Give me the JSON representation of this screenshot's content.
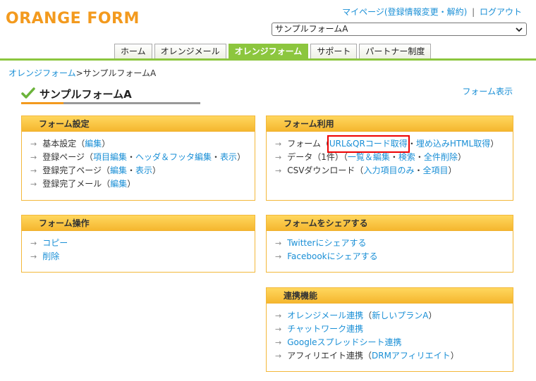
{
  "logo": {
    "text": "ORANGE FORM"
  },
  "top_links": {
    "mypage": "マイページ(登録情報変更・解約)",
    "separator": "|",
    "logout": "ログアウト"
  },
  "form_select": {
    "selected": "サンプルフォームA"
  },
  "tabs": [
    {
      "label": "ホーム"
    },
    {
      "label": "オレンジメール"
    },
    {
      "label": "オレンジフォーム"
    },
    {
      "label": "サポート"
    },
    {
      "label": "パートナー制度"
    }
  ],
  "breadcrumb": {
    "root": "オレンジフォーム",
    "sep": ">",
    "current": "サンプルフォームA"
  },
  "page_title": "サンプルフォームA",
  "form_view_link": "フォーム表示",
  "panels": {
    "settings": {
      "title": "フォーム設定",
      "basic": {
        "label": "基本設定（",
        "edit": "編集",
        "close": "）"
      },
      "regpage": {
        "label": "登録ページ（",
        "fields": "項目編集",
        "dot1": "・",
        "header": "ヘッダ＆フッタ編集",
        "dot2": "・",
        "view": "表示",
        "close": "）"
      },
      "donepage": {
        "label": "登録完了ページ（",
        "edit": "編集",
        "dot": "・",
        "view": "表示",
        "close": "）"
      },
      "donemail": {
        "label": "登録完了メール（",
        "edit": "編集",
        "close": "）"
      }
    },
    "usage": {
      "title": "フォーム利用",
      "form": {
        "label": "フォーム（",
        "url": "URL&QRコード取得",
        "dot": "・",
        "embed": "埋め込みHTML取得",
        "close": "）"
      },
      "data": {
        "label": "データ（1件）（",
        "list": "一覧＆編集",
        "dot1": "・",
        "search": "検索",
        "dot2": "・",
        "delete": "全件削除",
        "close": "）"
      },
      "csv": {
        "label": "CSVダウンロード（",
        "input": "入力項目のみ",
        "dot": "・",
        "all": "全項目",
        "close": "）"
      }
    },
    "ops": {
      "title": "フォーム操作",
      "copy": "コピー",
      "delete": "削除"
    },
    "share": {
      "title": "フォームをシェアする",
      "twitter": "Twitterにシェアする",
      "facebook": "Facebookにシェアする"
    },
    "integrations": {
      "title": "連携機能",
      "orange": {
        "label": "オレンジメール連携",
        "open": "（",
        "new_plan": "新しいプランA",
        "close": "）"
      },
      "chatwork": "チャットワーク連携",
      "gsheet": "Googleスプレッドシート連携",
      "affiliate": {
        "label": "アフィリエイト連携（",
        "drm": "DRMアフィリエイト",
        "close": "）"
      }
    }
  }
}
